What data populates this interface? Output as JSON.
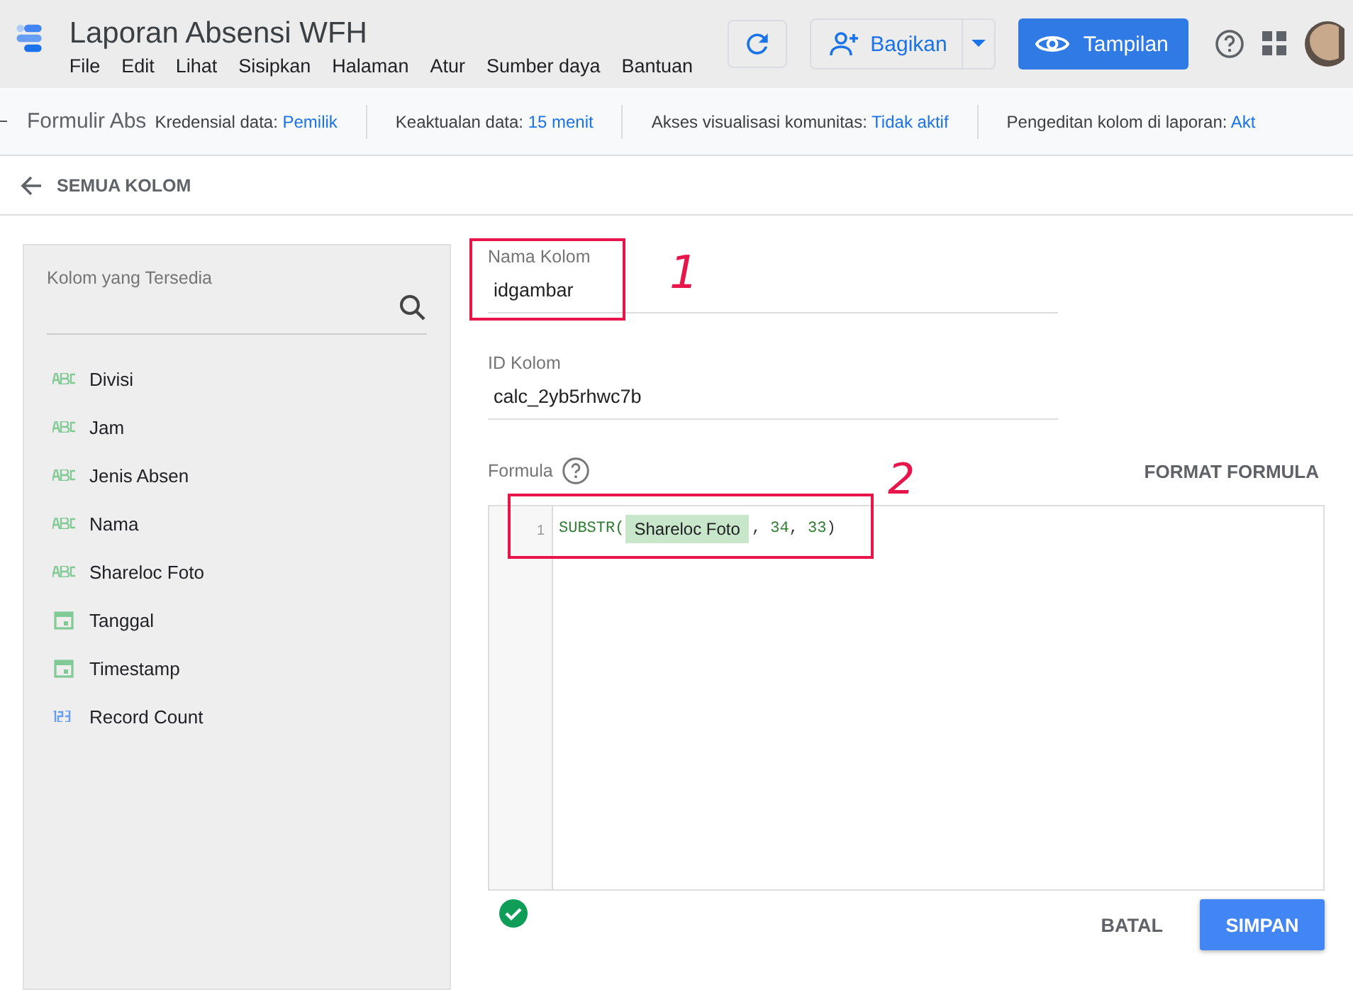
{
  "app": {
    "title": "Laporan Absensi WFH",
    "menu": [
      "File",
      "Edit",
      "Lihat",
      "Sisipkan",
      "Halaman",
      "Atur",
      "Sumber daya",
      "Bantuan"
    ],
    "share_label": "Bagikan",
    "view_label": "Tampilan"
  },
  "status_bar": {
    "report_name": "Formulir Abs",
    "items": [
      {
        "label": "Kredensial data:",
        "value": "Pemilik"
      },
      {
        "label": "Keaktualan data:",
        "value": "15 menit"
      },
      {
        "label": "Akses visualisasi komunitas:",
        "value": "Tidak aktif"
      },
      {
        "label": "Pengeditan kolom di laporan:",
        "value": "Akt"
      }
    ]
  },
  "back_label": "SEMUA KOLOM",
  "fields_panel": {
    "title": "Kolom yang Tersedia",
    "fields": [
      {
        "name": "Divisi",
        "kind": "text"
      },
      {
        "name": "Jam",
        "kind": "text"
      },
      {
        "name": "Jenis Absen",
        "kind": "text"
      },
      {
        "name": "Nama",
        "kind": "text"
      },
      {
        "name": "Shareloc Foto",
        "kind": "text"
      },
      {
        "name": "Tanggal",
        "kind": "date"
      },
      {
        "name": "Timestamp",
        "kind": "date"
      },
      {
        "name": "Record Count",
        "kind": "number"
      }
    ]
  },
  "editor": {
    "name_label": "Nama Kolom",
    "name_value": "idgambar",
    "id_label": "ID Kolom",
    "id_value": "calc_2yb5rhwc7b",
    "formula_label": "Formula",
    "format_label": "FORMAT FORMULA",
    "line_number": "1",
    "formula": {
      "func": "SUBSTR(",
      "field": "Shareloc Foto",
      "args": [
        ", ",
        "34",
        ", ",
        "33",
        ")"
      ]
    },
    "valid": true,
    "cancel_label": "BATAL",
    "save_label": "SIMPAN"
  },
  "annotations": [
    "1",
    "2"
  ]
}
